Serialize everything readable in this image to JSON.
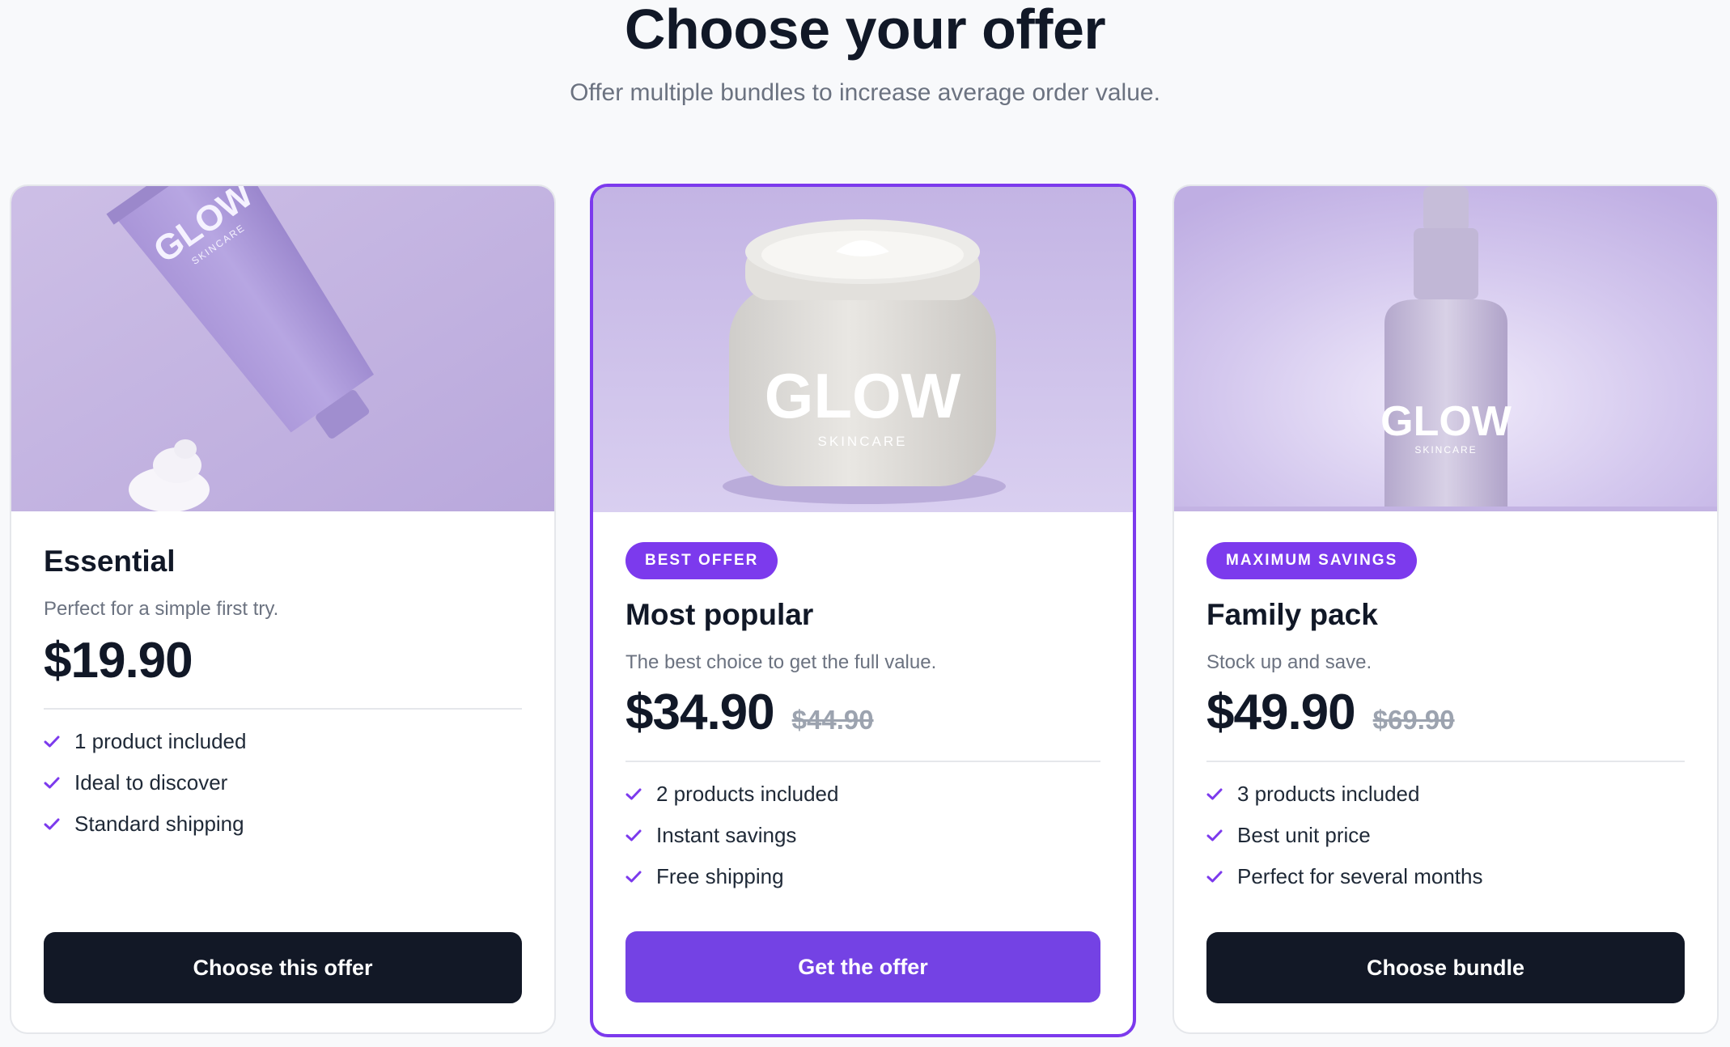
{
  "header": {
    "title": "Choose your offer",
    "subtitle": "Offer multiple bundles to increase average order value."
  },
  "brand": {
    "logo_text": "GLOW",
    "logo_sub": "SKINCARE"
  },
  "colors": {
    "accent": "#7c3aed",
    "dark_button": "#121826",
    "purple_button": "#7442e4"
  },
  "cards": [
    {
      "image_icon": "tube-icon",
      "badge": "",
      "name": "Essential",
      "description": "Perfect for a simple first try.",
      "price": "$19.90",
      "old_price": "",
      "features": [
        "1 product included",
        "Ideal to discover",
        "Standard shipping"
      ],
      "button": "Choose this offer"
    },
    {
      "image_icon": "jar-icon",
      "badge": "BEST OFFER",
      "name": "Most popular",
      "description": "The best choice to get the full value.",
      "price": "$34.90",
      "old_price": "$44.90",
      "features": [
        "2 products included",
        "Instant savings",
        "Free shipping"
      ],
      "button": "Get the offer"
    },
    {
      "image_icon": "dropper-bottle-icon",
      "badge": "MAXIMUM SAVINGS",
      "name": "Family pack",
      "description": "Stock up and save.",
      "price": "$49.90",
      "old_price": "$69.90",
      "features": [
        "3 products included",
        "Best unit price",
        "Perfect for several months"
      ],
      "button": "Choose bundle"
    }
  ]
}
